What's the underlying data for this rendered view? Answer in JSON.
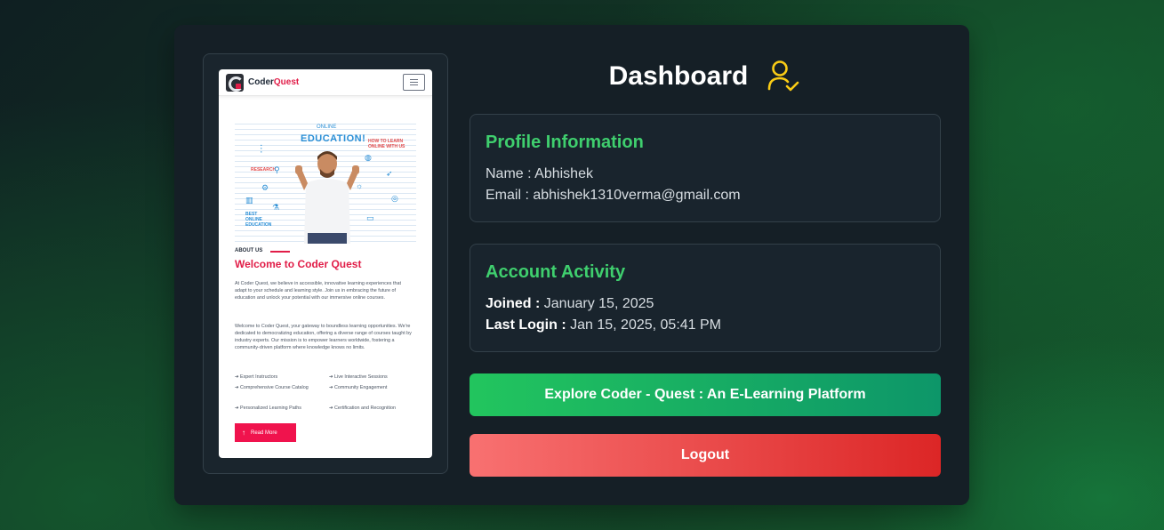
{
  "preview": {
    "brand_prefix": "Coder",
    "brand_suffix": "Quest",
    "hero_kicker": "ONLINE",
    "hero_title": "EDUCATION!",
    "hero_doodles": {
      "top_right": "HOW TO LEARN ONLINE WITH US",
      "research": "RESEARCH",
      "bottom_left": "BEST ONLINE EDUCATION"
    },
    "about_label": "ABOUT US",
    "heading": "Welcome to Coder Quest",
    "paragraph_1": "At Coder Quest, we believe in accessible, innovative learning experiences that adapt to your schedule and learning style. Join us in embracing the future of education and unlock your potential with our immersive online courses.",
    "paragraph_2": "Welcome to Coder Quest, your gateway to boundless learning opportunities. We're dedicated to democratizing education, offering a diverse range of courses taught by industry experts. Our mission is to empower learners worldwide, fostering a community-driven platform where knowledge knows no limits.",
    "features": [
      "Expert Instructors",
      "Live Interactive Sessions",
      "Comprehensive Course Catalog",
      "Community Engagement",
      "Personalized Learning Paths",
      "Certification and Recognition"
    ],
    "read_more": "Read More"
  },
  "dashboard": {
    "title": "Dashboard",
    "icon": "user-check-icon"
  },
  "profile": {
    "heading": "Profile Information",
    "name_label": "Name : ",
    "name": "Abhishek",
    "email_label": "Email : ",
    "email": "abhishek1310verma@gmail.com"
  },
  "activity": {
    "heading": "Account Activity",
    "joined_label": "Joined : ",
    "joined": "January 15, 2025",
    "last_login_label": "Last Login : ",
    "last_login": "Jan 15, 2025, 05:41 PM"
  },
  "buttons": {
    "explore": "Explore Coder - Quest : An E-Learning Platform",
    "logout": "Logout"
  },
  "colors": {
    "accent_green": "#3fcf6e",
    "icon_yellow": "#facc15",
    "brand_pink": "#e11d48",
    "card_bg": "#151f26"
  }
}
